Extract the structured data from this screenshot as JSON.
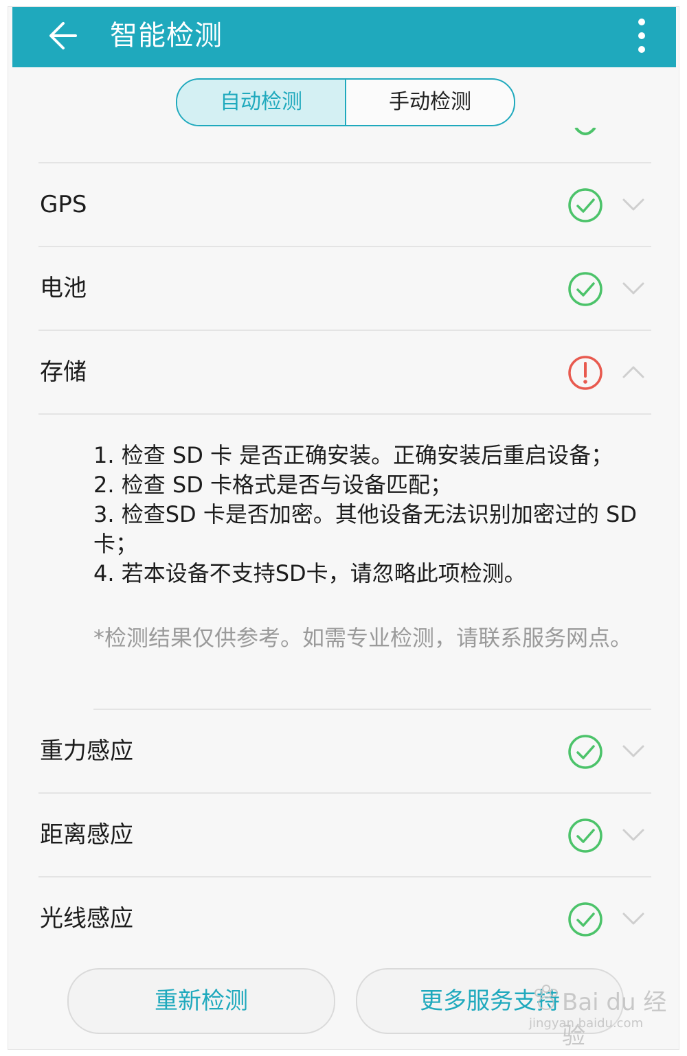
{
  "header": {
    "title": "智能检测"
  },
  "tabs": [
    {
      "label": "自动检测",
      "active": true
    },
    {
      "label": "手动检测",
      "active": false
    }
  ],
  "items": [
    {
      "label": "GPS",
      "status": "ok",
      "expanded": false
    },
    {
      "label": "电池",
      "status": "ok",
      "expanded": false
    },
    {
      "label": "存储",
      "status": "warning",
      "expanded": true
    },
    {
      "label": "重力感应",
      "status": "ok",
      "expanded": false
    },
    {
      "label": "距离感应",
      "status": "ok",
      "expanded": false
    },
    {
      "label": "光线感应",
      "status": "ok",
      "expanded": false
    }
  ],
  "storage_detail": {
    "lines": [
      "1. 检查 SD 卡 是否正确安装。正确安装后重启设备；",
      "2. 检查 SD 卡格式是否与设备匹配；",
      "3. 检查SD 卡是否加密。其他设备无法识别加密过的 SD 卡；",
      "4. 若本设备不支持SD卡，请忽略此项检测。"
    ],
    "note": "*检测结果仅供参考。如需专业检测，请联系服务网点。"
  },
  "buttons": {
    "retest": "重新检测",
    "more_service": "更多服务支持"
  },
  "watermark": {
    "main": "Bai du 经验",
    "sub": "jingyan.baidu.com"
  },
  "colors": {
    "accent": "#1fa9bd",
    "ok": "#4cc36a",
    "warning": "#e85a4f"
  },
  "icons": {
    "ok": "check-circle-icon",
    "warning": "exclamation-circle-icon",
    "collapsed": "chevron-down-icon",
    "expanded": "chevron-up-icon"
  }
}
